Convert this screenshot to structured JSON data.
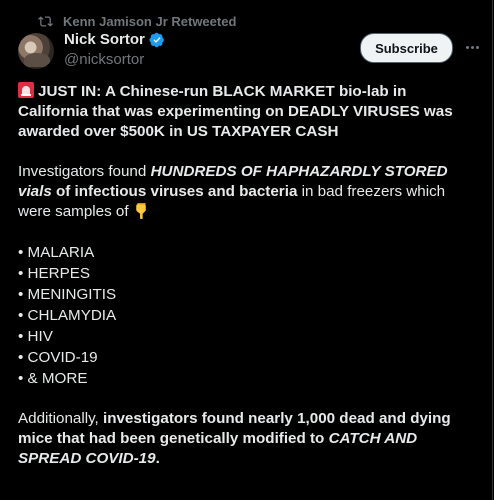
{
  "repost": {
    "label": "Kenn Jamison Jr Retweeted"
  },
  "author": {
    "display_name": "Nick Sortor",
    "handle": "@nicksortor"
  },
  "actions": {
    "subscribe_label": "Subscribe"
  },
  "tweet": {
    "headline": "JUST IN: A Chinese-run BLACK MARKET bio-lab in California that was experimenting on DEADLY VIRUSES was awarded over $500K in US TAXPAYER CASH",
    "p2_a": "Investigators found ",
    "p2_b": "HUNDREDS OF HAPHAZARDLY STORED vials",
    "p2_c": " of infectious viruses and bacteria",
    "p2_d": " in bad freezers which were samples of",
    "list": [
      "• MALARIA",
      "• HERPES",
      "• MENINGITIS",
      "• CHLAMYDIA",
      "• HIV",
      "• COVID-19",
      "• & MORE"
    ],
    "p4_a": "Additionally, ",
    "p4_b": "investigators found nearly 1,000 dead and dying mice that had been genetically modified to ",
    "p4_c": "CATCH AND SPREAD COVID-19",
    "p4_d": "."
  },
  "icons": {
    "repost": "repost-icon",
    "verified": "verified-badge-icon",
    "more": "more-options-icon",
    "siren": "rotating-light-emoji",
    "point": "backhand-index-pointing-down-emoji"
  },
  "colors": {
    "background": "#000000",
    "text": "#e7e9ea",
    "secondary": "#71767b",
    "verified": "#1d9bf0"
  }
}
